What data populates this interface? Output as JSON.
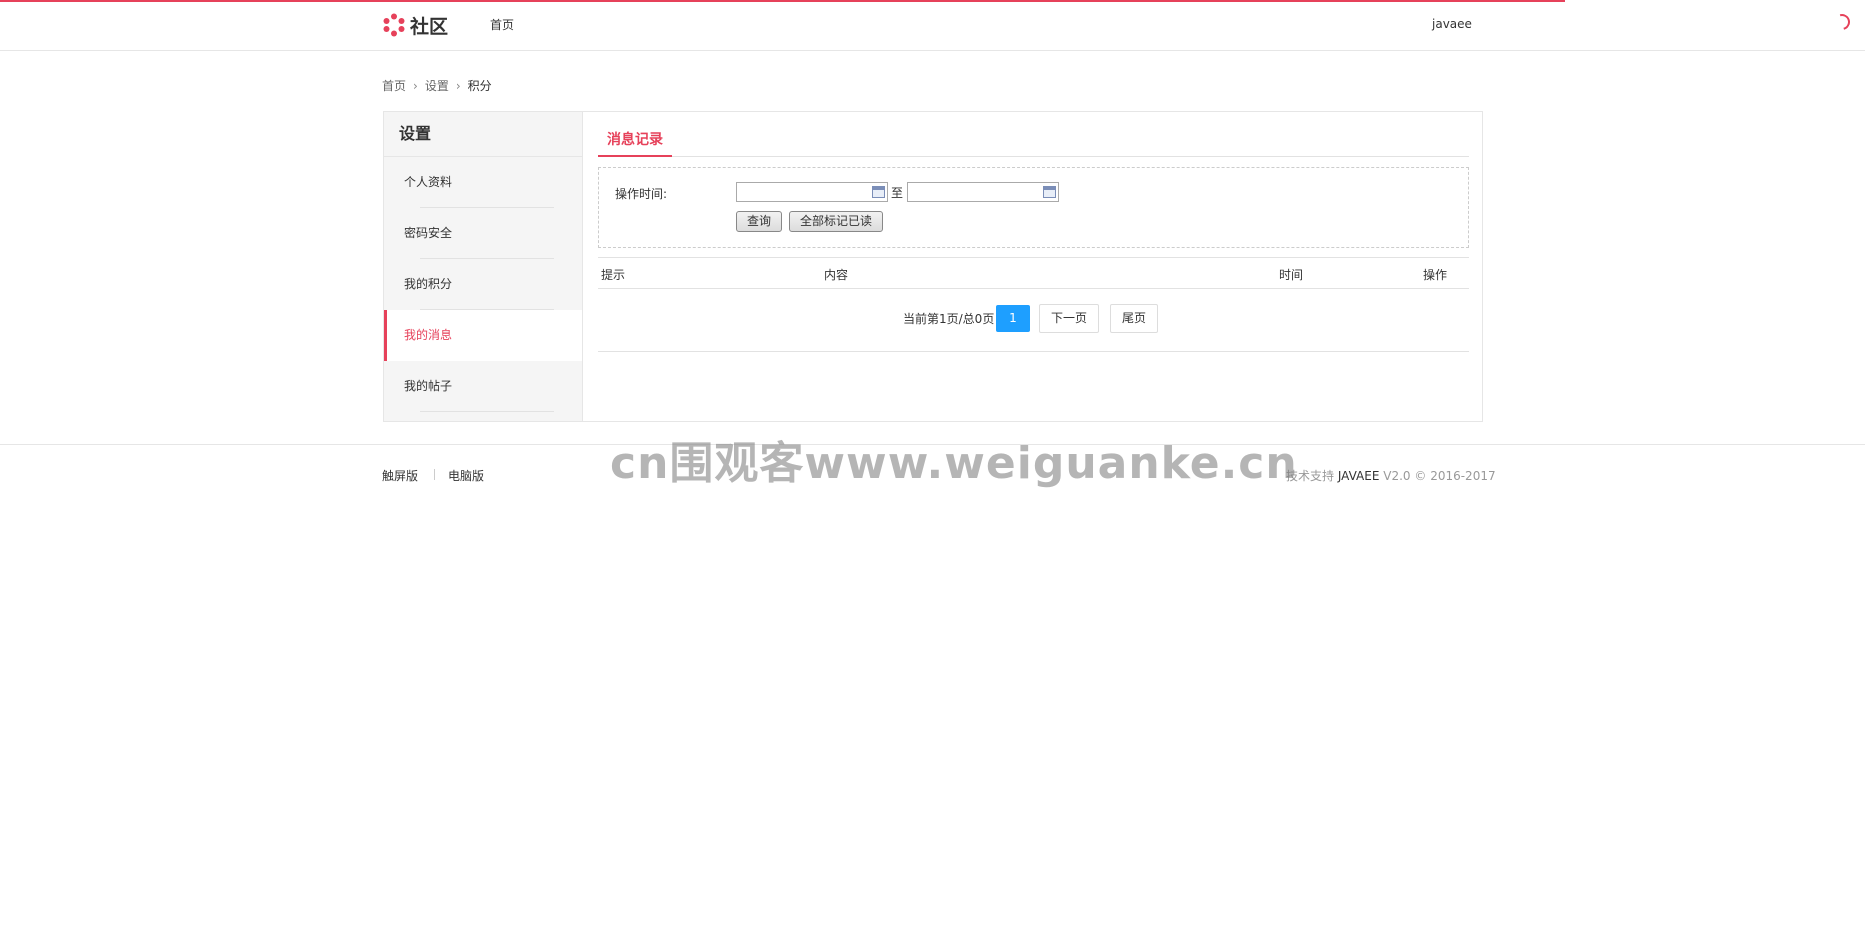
{
  "header": {
    "logo_text": "社区",
    "nav_home": "首页",
    "user_name": "javaee"
  },
  "breadcrumb": {
    "items": [
      "首页",
      "设置",
      "积分"
    ]
  },
  "sidebar": {
    "title": "设置",
    "items": [
      {
        "label": "个人资料"
      },
      {
        "label": "密码安全"
      },
      {
        "label": "我的积分"
      },
      {
        "label": "我的消息",
        "active": true
      },
      {
        "label": "我的帖子"
      }
    ]
  },
  "tabs": {
    "active_label": "消息记录"
  },
  "filter": {
    "label": "操作时间:",
    "start_value": "",
    "end_value": "",
    "to_label": "至",
    "query_button": "查询",
    "mark_all_button": "全部标记已读"
  },
  "table": {
    "columns": [
      "提示",
      "内容",
      "时间",
      "操作"
    ],
    "rows": []
  },
  "pager": {
    "info": "当前第1页/总0页",
    "current_page": "1",
    "next_label": "下一页",
    "last_label": "尾页"
  },
  "footer": {
    "links": [
      "触屏版",
      "电脑版"
    ],
    "copyright_prefix": "技术支持",
    "copyright_brand": "JAVAEE",
    "copyright_suffix": "V2.0 © 2016-2017"
  },
  "watermark": "cn围观客www.weiguanke.cn",
  "colors": {
    "accent": "#e6415a",
    "page_active": "#1e9fff"
  }
}
